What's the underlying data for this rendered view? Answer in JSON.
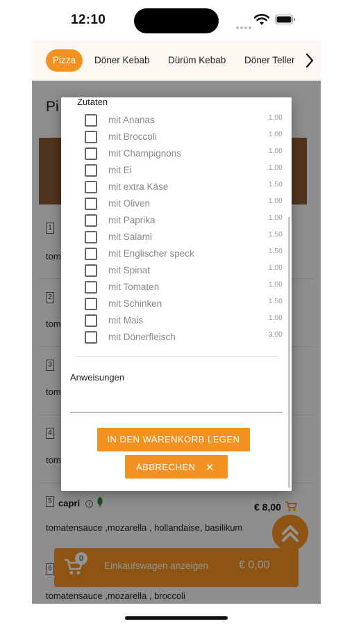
{
  "status": {
    "time": "12:10"
  },
  "tabs": [
    {
      "label": "Pizza",
      "active": true
    },
    {
      "label": "Döner Kebab",
      "active": false
    },
    {
      "label": "Dürüm Kebab",
      "active": false
    },
    {
      "label": "Döner Teller",
      "active": false
    }
  ],
  "page": {
    "title": "Pi",
    "rows": [
      {
        "num": "1",
        "desc": "toma"
      },
      {
        "num": "2",
        "desc": "toma"
      },
      {
        "num": "3",
        "desc": "toma"
      },
      {
        "num": "4",
        "desc": "toma"
      },
      {
        "num": "5",
        "desc": "tomatensauce ,mozarella , hollandaise, basilikum"
      },
      {
        "num": "6",
        "desc": "tomatensauce ,mozarella , broccoli"
      }
    ],
    "product_name": "capri",
    "info_glyph": "i",
    "price": "€ 8,00"
  },
  "cart": {
    "count": "0",
    "label": "Einkaufswagen anzeigen",
    "total": "€ 0,00"
  },
  "dialog": {
    "section_title": "Zutaten",
    "options": [
      {
        "label": "mit Ananas",
        "price": "1.00"
      },
      {
        "label": "mit Broccoli",
        "price": "1.00"
      },
      {
        "label": "mit Champignons",
        "price": "1.00"
      },
      {
        "label": "mit Ei",
        "price": "1.00"
      },
      {
        "label": "mit extra Käse",
        "price": "1.50"
      },
      {
        "label": "mit Oliven",
        "price": "1.00"
      },
      {
        "label": "mit Paprika",
        "price": "1.00"
      },
      {
        "label": "mit Salami",
        "price": "1.50"
      },
      {
        "label": "mit Englischer speck",
        "price": "1.50"
      },
      {
        "label": "mit Spinat",
        "price": "1.00"
      },
      {
        "label": "mit Tomaten",
        "price": "1.00"
      },
      {
        "label": "mit Schinken",
        "price": "1.50"
      },
      {
        "label": "mit Mais",
        "price": "1.00"
      },
      {
        "label": "mit Dönerfleisch",
        "price": "3.00"
      }
    ],
    "instructions_label": "Anweisungen",
    "instructions_value": "",
    "add_button": "IN DEN WARENKORB LEGEN",
    "cancel_button": "ABBRECHEN",
    "cancel_glyph": "✕"
  },
  "colors": {
    "accent": "#f39221",
    "tab_bg": "#fbf7f1",
    "muted_text": "#888888"
  },
  "icons": [
    "wifi-icon",
    "battery-icon",
    "chevron-right-icon",
    "cart-icon",
    "leaf-icon",
    "info-icon",
    "double-chevron-up-icon",
    "close-icon"
  ]
}
